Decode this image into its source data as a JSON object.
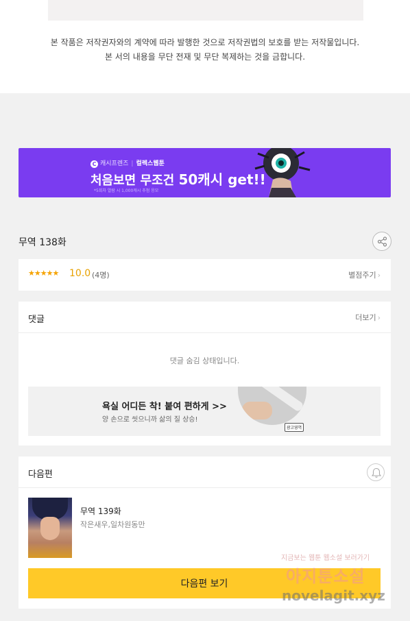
{
  "notice": {
    "line1": "본 작품은 저작권자와의 계약에 따라 발행한 것으로 저작권법의 보호를 받는 저작물입니다.",
    "line2": "본 서의 내용을 무단 전재 및 무단 복제하는 것을 금합니다."
  },
  "banner": {
    "brand_logo": "C",
    "brand": "캐시프렌즈",
    "divider": "|",
    "brand_sub": "컬렉스웹툰",
    "headline_prefix": "처음보면 무조건",
    "headline_highlight": "50캐시 get!!",
    "fine_print": "*5회차 열람 시 1,000캐시 추첨 응모",
    "accent_color": "#7a3cf0"
  },
  "episode": {
    "title": "무역 138화",
    "share_icon": "share-icon"
  },
  "rating": {
    "stars": "★★★★★",
    "score": "10.0",
    "count": "(4명)",
    "rate_link": "별점주기",
    "chevron": "›"
  },
  "comments": {
    "header": "댓글",
    "more_link": "더보기",
    "chevron": "›",
    "hidden_message": "댓글 숨김 상태입니다."
  },
  "ad": {
    "title": "욕실 어디든 착! 붙여 편하게 >>",
    "subtitle": "양 손으로 씻으니까 삶의 질 상승!",
    "badge": "광고영역"
  },
  "next_episode": {
    "header": "다음편",
    "title": "무역 139화",
    "author": "작은새우,일차원동만",
    "button_label": "다음편 보기",
    "button_color": "#ffc928",
    "bell_icon": "bell-icon"
  },
  "watermark": {
    "tagline": "지금보는 웹툰 웹소설 보러가기",
    "name": "아지툰소설",
    "url": "novelagit.xyz"
  }
}
